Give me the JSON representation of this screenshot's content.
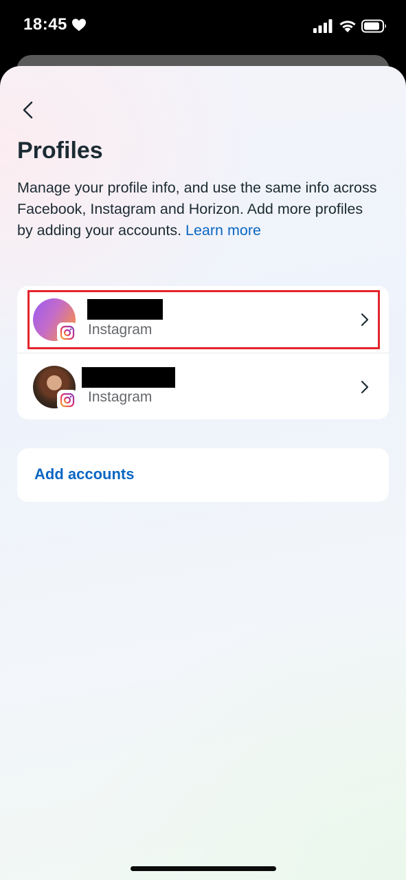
{
  "status_bar": {
    "time": "18:45",
    "icons": [
      "heart-icon",
      "signal-icon",
      "wifi-icon",
      "battery-icon"
    ]
  },
  "header": {
    "back_icon": "chevron-left-icon",
    "title": "Profiles"
  },
  "description": {
    "text": "Manage your profile info, and use the same info across Facebook, Instagram and Horizon. Add more profiles by adding your accounts. ",
    "link": "Learn more"
  },
  "profiles": [
    {
      "name": "",
      "name_redacted": true,
      "platform": "Instagram",
      "platform_icon": "instagram-icon",
      "highlighted": true
    },
    {
      "name": "",
      "name_redacted": true,
      "platform": "Instagram",
      "platform_icon": "instagram-icon",
      "highlighted": false
    }
  ],
  "add_accounts": {
    "label": "Add accounts"
  },
  "colors": {
    "link": "#0a66c2",
    "text": "#1c2b33",
    "secondary_text": "#65676b",
    "highlight": "#e3242b"
  }
}
